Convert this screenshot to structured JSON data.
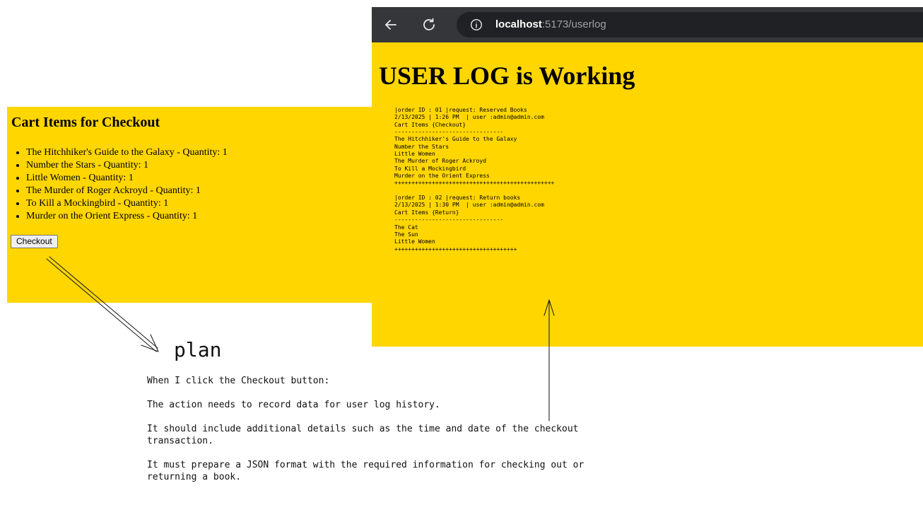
{
  "cart": {
    "title": "Cart Items for Checkout",
    "items": [
      "The Hitchhiker's Guide to the Galaxy - Quantity: 1",
      "Number the Stars - Quantity: 1",
      "Little Women - Quantity: 1",
      "The Murder of Roger Ackroyd - Quantity: 1",
      "To Kill a Mockingbird - Quantity: 1",
      "Murder on the Orient Express - Quantity: 1"
    ],
    "checkout_label": "Checkout",
    "background": "#FFD600"
  },
  "browser": {
    "url_host": "localhost",
    "url_path": ":5173/userlog",
    "icons": [
      "back-arrow-icon",
      "reload-icon",
      "site-info-icon"
    ]
  },
  "userlog": {
    "title": "USER LOG is Working",
    "log_text": "|order ID : 01 |request: Reserved Books\n2/13/2025 | 1:26 PM  | user :admin@admin.com\nCart Items {Checkout}\n--------------------------------\nThe Hitchhiker's Guide to the Galaxy\nNumber the Stars\nLittle Women\nThe Murder of Roger Ackroyd\nTo Kill a Mockingbird\nMurder on the Orient Express\n+++++++++++++++++++++++++++++++++++++++++++++++\n\n|order ID : 02 |request: Return books\n2/13/2025 | 1:30 PM  | user :admin@admin.com\nCart Items {Return}\n--------------------------------\nThe Cat\nThe Sun\nLittle Women\n++++++++++++++++++++++++++++++++++++"
  },
  "annotation": {
    "heading": "plan",
    "lines": [
      "When I click the Checkout button:",
      "The action needs to record data for user log history.",
      "It should include additional details such as the time and date of the checkout\ntransaction.",
      "It must prepare a JSON format with the required information for checking out or\nreturning a book."
    ]
  }
}
